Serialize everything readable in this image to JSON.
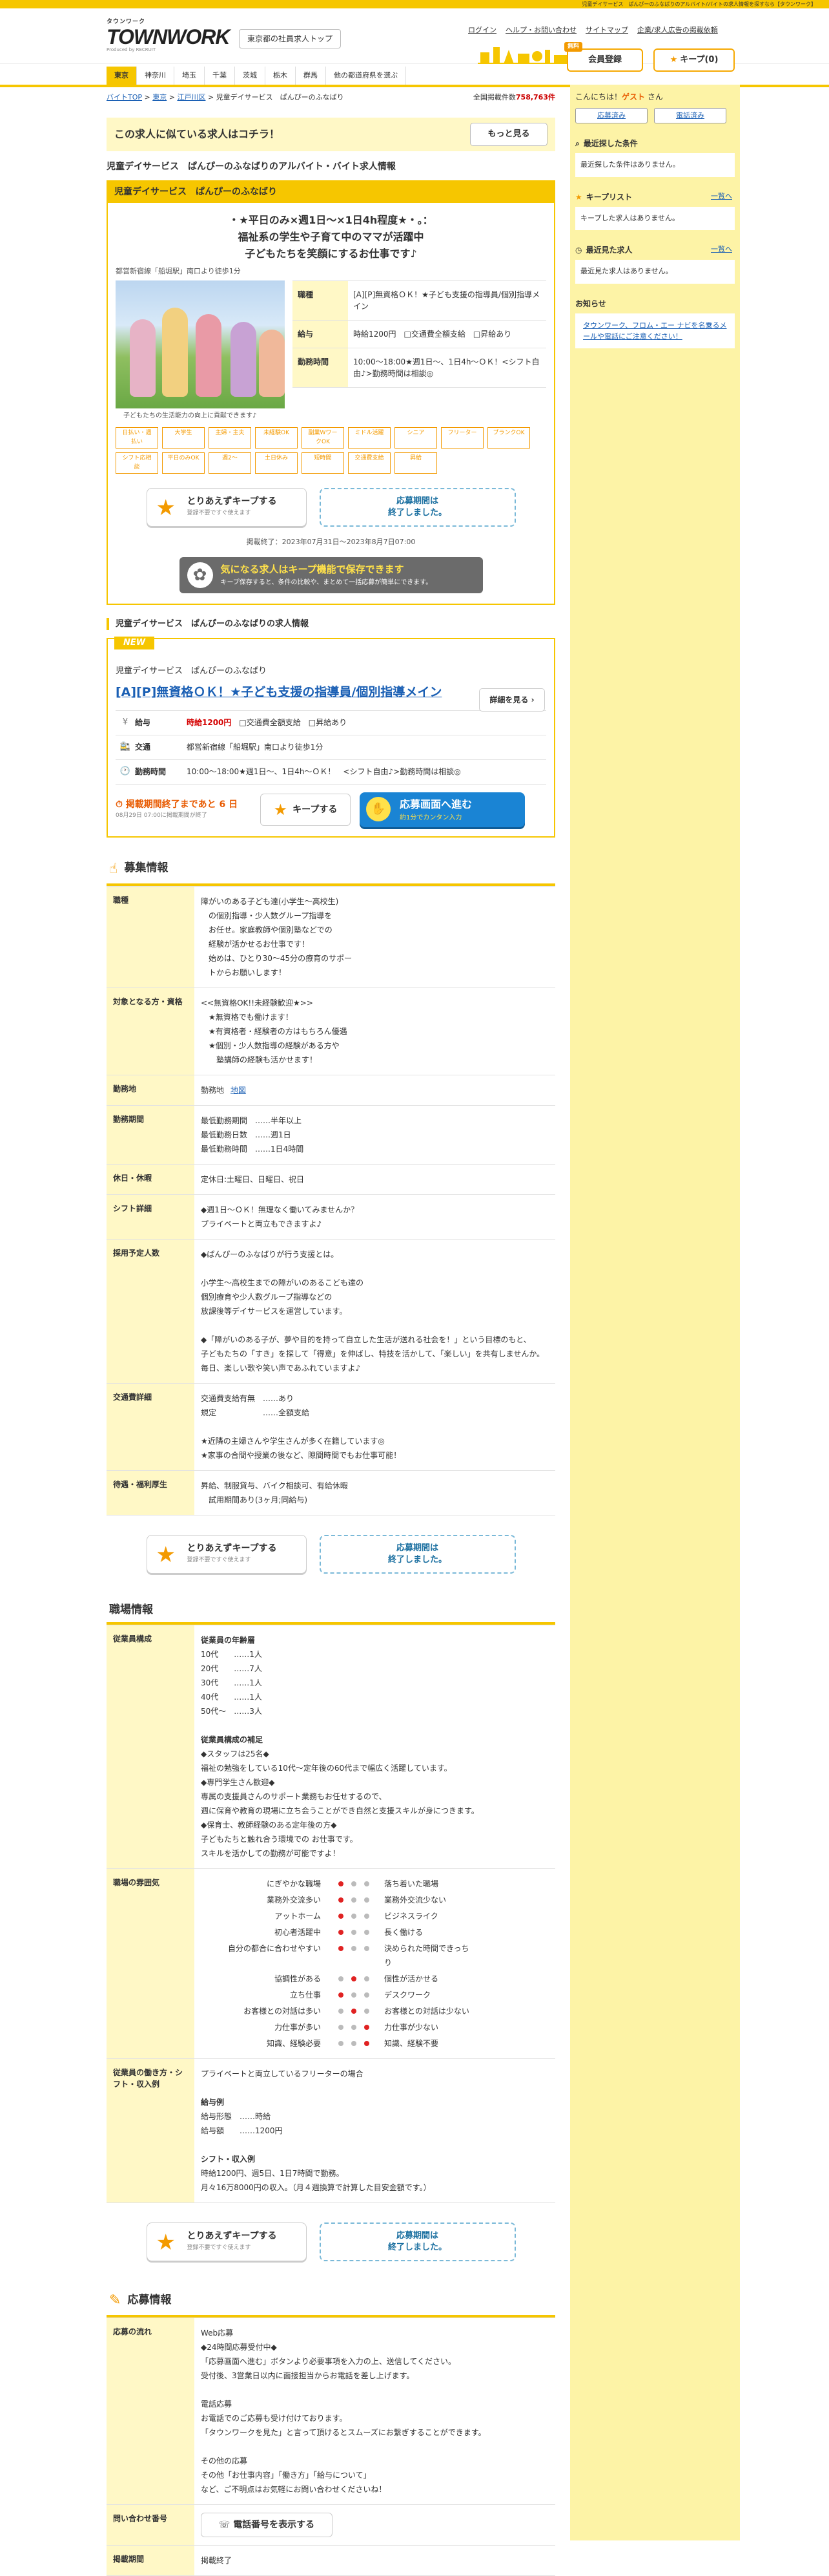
{
  "top_strip": "児童デイサービス　ぱんぴーのふなばりのアルバイト/バイトの求人情報を探すなら【タウンワーク】",
  "header": {
    "logo_top": "タウンワーク",
    "logo_main_a": "TOWN",
    "logo_main_b": "WORK",
    "logo_sub": "Produced by RECRUIT",
    "region_button": "東京都の社員求人トップ",
    "links": [
      "ログイン",
      "ヘルプ・お問い合わせ",
      "サイトマップ",
      "企業/求人広告の掲載依頼"
    ],
    "register_free": "無料",
    "register": "会員登録",
    "keep": "キープ(0)"
  },
  "region_nav": [
    "東京",
    "神奈川",
    "埼玉",
    "千葉",
    "茨城",
    "栃木",
    "群馬",
    "他の都道府県を選ぶ"
  ],
  "breadcrumb": [
    "バイトTOP",
    "東京",
    "江戸川区",
    "児童デイサービス　ぱんぴーのふなばり"
  ],
  "total_count_label": "全国掲載件数",
  "total_count": "758,763件",
  "similar_banner": {
    "text": "この求人に似ている求人はコチラ！",
    "more": "もっと見る"
  },
  "page_title": "児童デイサービス　ぱんぴーのふなばりのアルバイト・バイト求人情報",
  "job_card": {
    "head": "児童デイサービス　ぱんぴーのふなばり",
    "catch": [
      "・★平日のみ×週1日～×1日4h程度★・。：",
      "福祉系の学生や子育て中のママが活躍中",
      "子どもたちを笑顔にするお仕事です♪"
    ],
    "access": "都営新宿線「船堀駅」南口より徒歩1分",
    "photo_caption": "子どもたちの生活能力の向上に貢献できます♪",
    "rows": [
      {
        "th": "職種",
        "td": "[A][P]無資格ＯＫ！★子ども支援の指導員/個別指導メイン"
      },
      {
        "th": "給与",
        "td": "時給1200円　□交通費全額支給　□昇給あり"
      },
      {
        "th": "勤務時間",
        "td": "10:00～18:00★週1日～、1日4h～ＯＫ！<シフト自由♪>勤務時間は相談◎"
      }
    ],
    "tags": [
      "日払い・週払い",
      "大学生",
      "主婦・主夫",
      "未経験OK",
      "副業WワークOK",
      "ミドル活躍",
      "シニア",
      "フリーター",
      "ブランクOK",
      "シフト応相談",
      "平日のみOK",
      "週2～",
      "土日休み",
      "短時間",
      "交通費支給",
      "昇給"
    ],
    "try_keep": "とりあえずキープする",
    "try_keep_sub": "登録不要ですぐ使えます",
    "closed_1": "応募期間は",
    "closed_2": "終了しました。",
    "period": "掲載終了：2023年07月31日～2023年8月7日07:00"
  },
  "keep_banner": {
    "t1": "気になる求人はキープ機能で保存できます",
    "t2": "キープ保存すると、条件の比較や、まとめて一括応募が簡単にできます。"
  },
  "summary": {
    "section_title": "児童デイサービス　ぱんぴーのふなばりの求人情報",
    "new": "NEW",
    "corp": "児童デイサービス　ぱんぴーのふなばり",
    "title": "[A][P]無資格ＯＫ！★子ども支援の指導員/個別指導メイン",
    "detail_btn": "詳細を見る",
    "rows": [
      {
        "icon": "¥",
        "th": "給与",
        "td_red": "時給1200円",
        "td": "□交通費全額支給　□昇給あり"
      },
      {
        "icon": "🚉",
        "th": "交通",
        "td_red": "",
        "td": "都営新宿線「船堀駅」南口より徒歩1分"
      },
      {
        "icon": "🕐",
        "th": "勤務時間",
        "td_red": "",
        "td": "10:00～18:00★週1日～、1日4h～ＯＫ！　<シフト自由♪>勤務時間は相談◎"
      }
    ],
    "deadline": "掲載期間終了まであと 6 日",
    "deadline_sub": "08月29日 07:00に掲載期間が終了",
    "keep": "キープする",
    "apply": "応募画面へ進む",
    "apply_sub": "約1分でカンタン入力"
  },
  "recruit": {
    "title": "募集情報",
    "rows": [
      {
        "th": "職種",
        "td": "障がいのある子ども達(小学生～高校生)\n　の個別指導・少人数グループ指導を\n　お任せ。家庭教師や個別塾などでの\n　経験が活かせるお仕事です！\n　始めは、ひとり30～45分の療育のサポー\n　トからお願いします！"
      },
      {
        "th": "対象となる方・資格",
        "td": "<<無資格OK!!未経験歓迎★>>\n　★無資格でも働けます！\n　★有資格者・経験者の方はもちろん優遇\n　★個別・少人数指導の経験がある方や\n　　塾講師の経験も活かせます！"
      },
      {
        "th": "勤務地",
        "td": "勤務地",
        "map": "地図"
      },
      {
        "th": "勤務期間",
        "td": "最低勤務期間　……半年以上\n最低勤務日数　……週1日\n最低勤務時間　……1日4時間"
      },
      {
        "th": "休日・休暇",
        "td": "定休日:土曜日、日曜日、祝日"
      },
      {
        "th": "シフト詳細",
        "td": "◆週1日～ＯＫ！無理なく働いてみませんか？\nプライベートと両立もできますよ♪"
      },
      {
        "th": "採用予定人数",
        "td": "◆ぱんぴーのふなばりが行う支援とは。\n\n小学生～高校生までの障がいのあるこども達の\n個別療育や少人数グループ指導などの\n放課後等デイサービスを運営しています。\n\n◆「障がいのある子が、夢や目的を持って自立した生活が送れる社会を！」という目標のもと、\n子どもたちの「すき」を探して「得意」を伸ばし、特技を活かして、「楽しい」を共有しませんか。\n毎日、楽しい歌や笑い声であふれていますよ♪"
      },
      {
        "th": "交通費詳細",
        "td": "交通費支給有無　……あり\n規定　　　　　　……全額支給\n\n★近隣の主婦さんや学生さんが多く在籍しています◎\n★家事の合間や授業の後など、隙間時間でもお仕事可能！"
      },
      {
        "th": "待遇・福利厚生",
        "td": "昇給、制服貸与、バイク相談可、有給休暇\n　試用期間あり(3ヶ月;同給与)"
      }
    ]
  },
  "workplace": {
    "title": "職場情報",
    "rows": [
      {
        "th": "従業員構成",
        "sub1": "従業員の年齢層",
        "td": "10代　　……1人\n20代　　……7人\n30代　　……1人\n40代　　……1人\n50代～　……3人",
        "sub2": "従業員構成の補足",
        "td2": "◆スタッフは25名◆\n福祉の勉強をしている10代～定年後の60代まで幅広く活躍しています。\n◆専門学生さん歓迎◆\n専属の支援員さんのサポート業務もお任せするので、\n週に保育や教育の現場に立ち会うことができ自然と支援スキルが身につきます。\n◆保育士、教師経験のある定年後の方◆\n子どもたちと触れ合う環境での お仕事です。\nスキルを活かしての勤務が可能ですよ！"
      },
      {
        "th": "職場の雰囲気"
      },
      {
        "th": "従業員の働き方・シフト・収入例",
        "td": "プライベートと両立しているフリーターの場合",
        "sub1": "給与例",
        "td_b": "給与形態　……時給\n給与額　　……1200円",
        "sub2": "シフト・収入例",
        "td2": "時給1200円、週5日、1日7時間で勤務。\n月々16万8000円の収入。（月４週換算で計算した目安金額です。）"
      }
    ],
    "atmosphere": [
      {
        "l": "にぎやかな職場",
        "r": "落ち着いた職場",
        "on": 0
      },
      {
        "l": "業務外交流多い",
        "r": "業務外交流少ない",
        "on": 0
      },
      {
        "l": "アットホーム",
        "r": "ビジネスライク",
        "on": 0
      },
      {
        "l": "初心者活躍中",
        "r": "長く働ける",
        "on": 0
      },
      {
        "l": "自分の都合に合わせやすい",
        "r": "決められた時間できっちり",
        "on": 0
      },
      {
        "l": "協調性がある",
        "r": "個性が活かせる",
        "on": 1
      },
      {
        "l": "立ち仕事",
        "r": "デスクワーク",
        "on": 0
      },
      {
        "l": "お客様との対話は多い",
        "r": "お客様との対話は少ない",
        "on": 1
      },
      {
        "l": "力仕事が多い",
        "r": "力仕事が少ない",
        "on": 2
      },
      {
        "l": "知識、経験必要",
        "r": "知識、経験不要",
        "on": 2
      }
    ]
  },
  "apply_info": {
    "title": "応募情報",
    "rows": [
      {
        "th": "応募の流れ",
        "td": "Web応募\n◆24時間応募受付中◆\n「応募画面へ進む」ボタンより必要事項を入力の上、送信してください。\n受付後、3営業日以内に面接担当からお電話を差し上げます。\n\n電話応募\nお電話でのご応募も受け付けております。\n「タウンワークを見た」と言って頂けるとスムーズにお繋ぎすることができます。\n\nその他の応募\nその他「お仕事内容」「働き方」「給与について」\nなど、ご不明点はお気軽にお問い合わせくださいね！"
      },
      {
        "th": "問い合わせ番号",
        "phone": "電話番号を表示する"
      },
      {
        "th": "掲載期間",
        "td": "掲載終了"
      }
    ]
  },
  "sidebar": {
    "greet_a": "こんにちは！",
    "guest": "ゲスト",
    "greet_b": "さん",
    "btn_apply": "応募済み",
    "btn_phone": "電話済み",
    "recent_cond_title": "最近探した条件",
    "recent_cond_empty": "最近探した条件はありません。",
    "keeplist_title": "キープリスト",
    "keeplist_more": "一覧へ",
    "keeplist_empty": "キープした求人はありません。",
    "recent_view_title": "最近見た求人",
    "recent_view_more": "一覧へ",
    "recent_view_empty": "最近見た求人はありません。",
    "notice_title": "お知らせ",
    "notice_text": "タウンワーク、フロム・エー ナビを名乗るメールや電話にご注意ください！"
  }
}
